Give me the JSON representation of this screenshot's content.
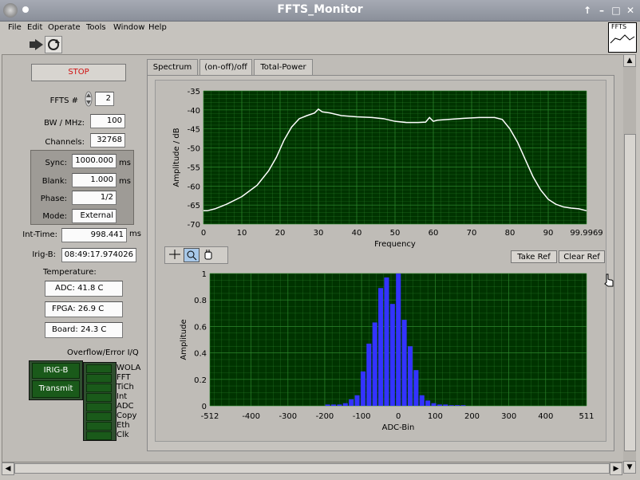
{
  "window": {
    "title": "FFTS_Monitor"
  },
  "menu": [
    "File",
    "Edit",
    "Operate",
    "Tools",
    "Window",
    "Help"
  ],
  "logo_text": "FFTS",
  "left": {
    "stop_label": "STOP",
    "ffts_num_label": "FFTS #",
    "ffts_num": "2",
    "bw_label": "BW / MHz:",
    "bw": "100",
    "channels_label": "Channels:",
    "channels": "32768",
    "sync_label": "Sync:",
    "sync": "1000.000",
    "sync_unit": "ms",
    "blank_label": "Blank:",
    "blank": "1.000",
    "blank_unit": "ms",
    "phase_label": "Phase:",
    "phase": "1/2",
    "mode_label": "Mode:",
    "mode": "External",
    "inttime_label": "Int-Time:",
    "inttime": "998.441",
    "inttime_unit": "ms",
    "irigb_label": "Irig-B:",
    "irigb": "08:49:17.974026",
    "temperature_label": "Temperature:",
    "adc_temp": "ADC: 41.8 C",
    "fpga_temp": "FPGA: 26.9 C",
    "board_temp": "Board: 24.3 C",
    "overflow_label": "Overflow/Error I/Q",
    "irig_btn": "IRIG-B",
    "transmit_btn": "Transmit",
    "leds": [
      "WOLA",
      "FFT",
      "TiCh",
      "Int",
      "ADC",
      "Copy",
      "Eth",
      "Clk"
    ]
  },
  "tabs": [
    "Spectrum",
    "(on-off)/off",
    "Total-Power"
  ],
  "buttons": {
    "take_ref": "Take Ref",
    "clear_ref": "Clear Ref"
  },
  "colors": {
    "plot_bg": "#003300",
    "grid": "#2f8a2f",
    "trace": "#ffffff",
    "bars": "#3333ff"
  },
  "chart_data": [
    {
      "type": "line",
      "title": "",
      "xlabel": "Frequency",
      "ylabel": "Amplitude / dB",
      "xlim": [
        0,
        99.9969
      ],
      "ylim": [
        -70,
        -35
      ],
      "xticks": [
        "0",
        "10",
        "20",
        "30",
        "40",
        "50",
        "60",
        "70",
        "80",
        "90",
        "99.9969"
      ],
      "yticks": [
        "-35",
        "-40",
        "-45",
        "-50",
        "-55",
        "-60",
        "-65",
        "-70"
      ],
      "grid": true,
      "series": [
        {
          "x": [
            0,
            1,
            3,
            6,
            10,
            14,
            17,
            19,
            21,
            23,
            25,
            27,
            29,
            30,
            31,
            33,
            36,
            40,
            44,
            47,
            50,
            53,
            56,
            58,
            59,
            60,
            61,
            64,
            68,
            72,
            76,
            78,
            80,
            82,
            84,
            86,
            88,
            90,
            92,
            94,
            96,
            98,
            99.9969
          ],
          "y": [
            -66.5,
            -66.5,
            -66,
            -64.8,
            -62.8,
            -59.8,
            -56,
            -52.5,
            -48,
            -44.5,
            -42.3,
            -41.5,
            -40.8,
            -39.8,
            -40.5,
            -40.8,
            -41.5,
            -41.8,
            -42,
            -42.3,
            -43,
            -43.3,
            -43.3,
            -43.2,
            -42,
            -43,
            -42.7,
            -42.5,
            -42.2,
            -42,
            -42,
            -42.5,
            -45,
            -48.5,
            -53,
            -57.5,
            -61,
            -63.5,
            -64.8,
            -65.5,
            -65.8,
            -66,
            -66.5
          ]
        }
      ]
    },
    {
      "type": "bar",
      "title": "",
      "xlabel": "ADC-Bin",
      "ylabel": "Amplitude",
      "xlim": [
        -512,
        511
      ],
      "ylim": [
        0,
        1
      ],
      "xticks": [
        "-512",
        "-400",
        "-300",
        "-200",
        "-100",
        "0",
        "100",
        "200",
        "300",
        "400",
        "511"
      ],
      "yticks": [
        "1",
        "0.8",
        "0.6",
        "0.4",
        "0.2",
        "0"
      ],
      "grid": true,
      "x": [
        -192,
        -176,
        -160,
        -144,
        -128,
        -112,
        -96,
        -80,
        -64,
        -48,
        -32,
        -16,
        0,
        16,
        32,
        48,
        64,
        80,
        96,
        112,
        128,
        144,
        160,
        176
      ],
      "values": [
        0.01,
        0.01,
        0.01,
        0.02,
        0.05,
        0.08,
        0.26,
        0.47,
        0.63,
        0.89,
        0.97,
        0.77,
        1.0,
        0.65,
        0.45,
        0.27,
        0.08,
        0.04,
        0.02,
        0.01,
        0.01,
        0.005,
        0.005,
        0.005
      ]
    }
  ]
}
